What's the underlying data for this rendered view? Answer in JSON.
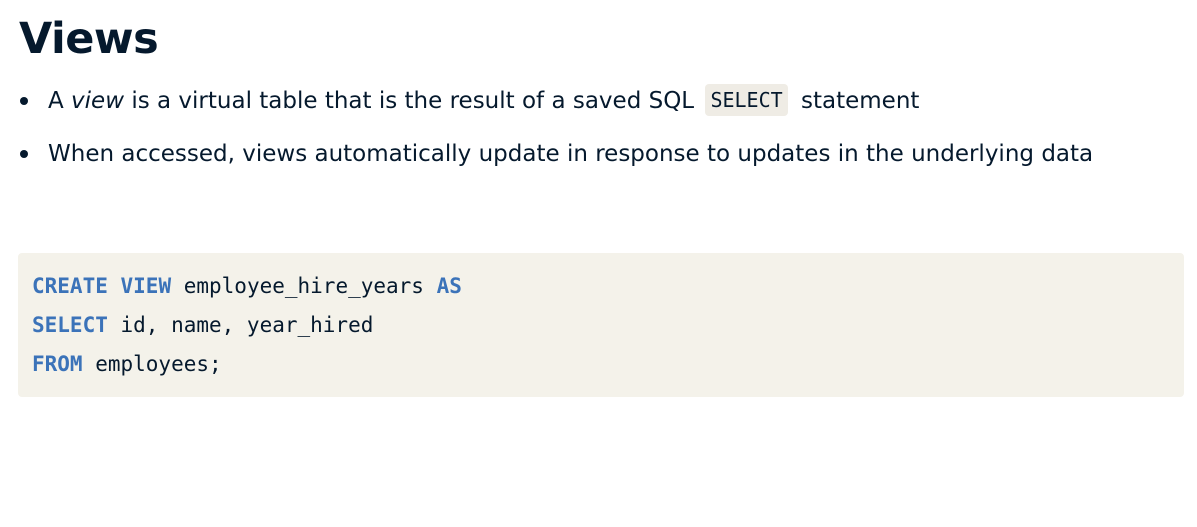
{
  "page": {
    "title": "Views"
  },
  "bullets": [
    {
      "parts": [
        "A ",
        "view",
        " is a virtual table that is the result of a saved SQL ",
        "SELECT",
        " statement"
      ]
    },
    {
      "text": "When accessed, views automatically update in response to updates in the underlying data"
    }
  ],
  "code": {
    "lines": [
      {
        "kw1": "CREATE",
        "sp1": " ",
        "kw2": "VIEW",
        "text": " employee_hire_years ",
        "kw3": "AS"
      },
      {
        "kw1": "SELECT",
        "text": " id, name, year_hired"
      },
      {
        "kw1": "FROM",
        "text": " employees;"
      }
    ]
  },
  "colors": {
    "text": "#05192d",
    "keyword": "#3b73b9",
    "code_background": "#f4f2ea",
    "inline_code_background": "#efece5"
  }
}
